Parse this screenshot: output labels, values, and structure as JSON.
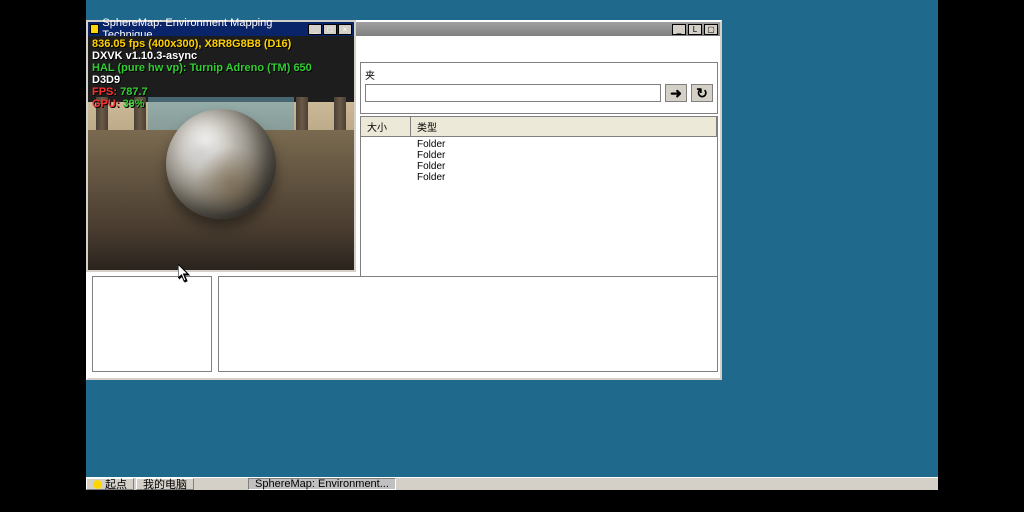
{
  "dx": {
    "title": "SphereMap: Environment Mapping Technique",
    "hud": {
      "line1": "836.05 fps (400x300), X8R8G8B8 (D16)",
      "line2": "DXVK v1.10.3-async",
      "line3": "HAL (pure hw vp): Turnip Adreno (TM) 650",
      "line4": "D3D9",
      "fps_label": "FPS:",
      "fps_value": "787.7",
      "gpu_label": "GPU:",
      "gpu_value": "39%"
    },
    "buttons": {
      "min": "_",
      "max": "□",
      "close": "×"
    }
  },
  "browser": {
    "nav_label": "夹",
    "path_value": "",
    "go": "➜",
    "refresh": "↻",
    "col_size": "大小",
    "col_type": "类型",
    "rows": [
      {
        "type": "Folder"
      },
      {
        "type": "Folder"
      },
      {
        "type": "Folder"
      },
      {
        "type": "Folder"
      }
    ],
    "buttons": {
      "min": "_",
      "max": "L",
      "close": "▢"
    }
  },
  "taskbar": {
    "start": "起点",
    "items": [
      {
        "label": "我的电脑",
        "active": false
      },
      {
        "label": "SphereMap: Environment...",
        "active": true
      }
    ]
  }
}
